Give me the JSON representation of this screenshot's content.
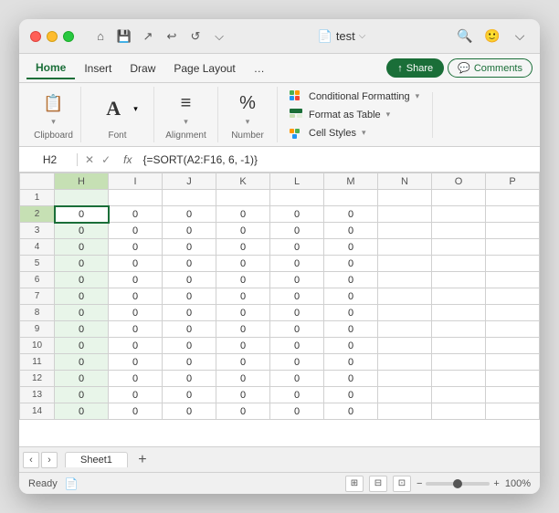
{
  "window": {
    "title": "test",
    "traffic_lights": [
      "red",
      "yellow",
      "green"
    ]
  },
  "ribbon_tabs": {
    "tabs": [
      "Home",
      "Insert",
      "Draw",
      "Page Layout"
    ],
    "active": "Home",
    "overflow": "…",
    "share_label": "Share",
    "comments_label": "Comments"
  },
  "ribbon": {
    "groups": [
      {
        "name": "Clipboard",
        "label": "Clipboard",
        "icon": "📋"
      },
      {
        "name": "Font",
        "label": "Font",
        "icon": "A"
      },
      {
        "name": "Alignment",
        "label": "Alignment",
        "icon": "≡"
      },
      {
        "name": "Number",
        "label": "Number",
        "icon": "%"
      }
    ],
    "styles": {
      "conditional_formatting": "Conditional Formatting",
      "format_as_table": "Format as Table",
      "cell_styles": "Cell Styles"
    }
  },
  "formula_bar": {
    "cell_ref": "H2",
    "cancel": "✕",
    "confirm": "✓",
    "fx": "fx",
    "formula": "{=SORT(A2:F16, 6, -1)}"
  },
  "spreadsheet": {
    "col_headers": [
      "H",
      "I",
      "J",
      "K",
      "L",
      "M",
      "N",
      "O",
      "P"
    ],
    "rows": [
      {
        "num": 1,
        "cells": [
          "",
          "",
          "",
          "",
          "",
          "",
          "",
          "",
          ""
        ]
      },
      {
        "num": 2,
        "cells": [
          "0",
          "0",
          "0",
          "0",
          "0",
          "0",
          "",
          "",
          ""
        ]
      },
      {
        "num": 3,
        "cells": [
          "0",
          "0",
          "0",
          "0",
          "0",
          "0",
          "",
          "",
          ""
        ]
      },
      {
        "num": 4,
        "cells": [
          "0",
          "0",
          "0",
          "0",
          "0",
          "0",
          "",
          "",
          ""
        ]
      },
      {
        "num": 5,
        "cells": [
          "0",
          "0",
          "0",
          "0",
          "0",
          "0",
          "",
          "",
          ""
        ]
      },
      {
        "num": 6,
        "cells": [
          "0",
          "0",
          "0",
          "0",
          "0",
          "0",
          "",
          "",
          ""
        ]
      },
      {
        "num": 7,
        "cells": [
          "0",
          "0",
          "0",
          "0",
          "0",
          "0",
          "",
          "",
          ""
        ]
      },
      {
        "num": 8,
        "cells": [
          "0",
          "0",
          "0",
          "0",
          "0",
          "0",
          "",
          "",
          ""
        ]
      },
      {
        "num": 9,
        "cells": [
          "0",
          "0",
          "0",
          "0",
          "0",
          "0",
          "",
          "",
          ""
        ]
      },
      {
        "num": 10,
        "cells": [
          "0",
          "0",
          "0",
          "0",
          "0",
          "0",
          "",
          "",
          ""
        ]
      },
      {
        "num": 11,
        "cells": [
          "0",
          "0",
          "0",
          "0",
          "0",
          "0",
          "",
          "",
          ""
        ]
      },
      {
        "num": 12,
        "cells": [
          "0",
          "0",
          "0",
          "0",
          "0",
          "0",
          "",
          "",
          ""
        ]
      },
      {
        "num": 13,
        "cells": [
          "0",
          "0",
          "0",
          "0",
          "0",
          "0",
          "",
          "",
          ""
        ]
      },
      {
        "num": 14,
        "cells": [
          "0",
          "0",
          "0",
          "0",
          "0",
          "0",
          "",
          "",
          ""
        ]
      }
    ]
  },
  "sheet_tabs": {
    "tabs": [
      "Sheet1"
    ],
    "active": "Sheet1"
  },
  "status_bar": {
    "ready": "Ready",
    "zoom": "100%"
  }
}
